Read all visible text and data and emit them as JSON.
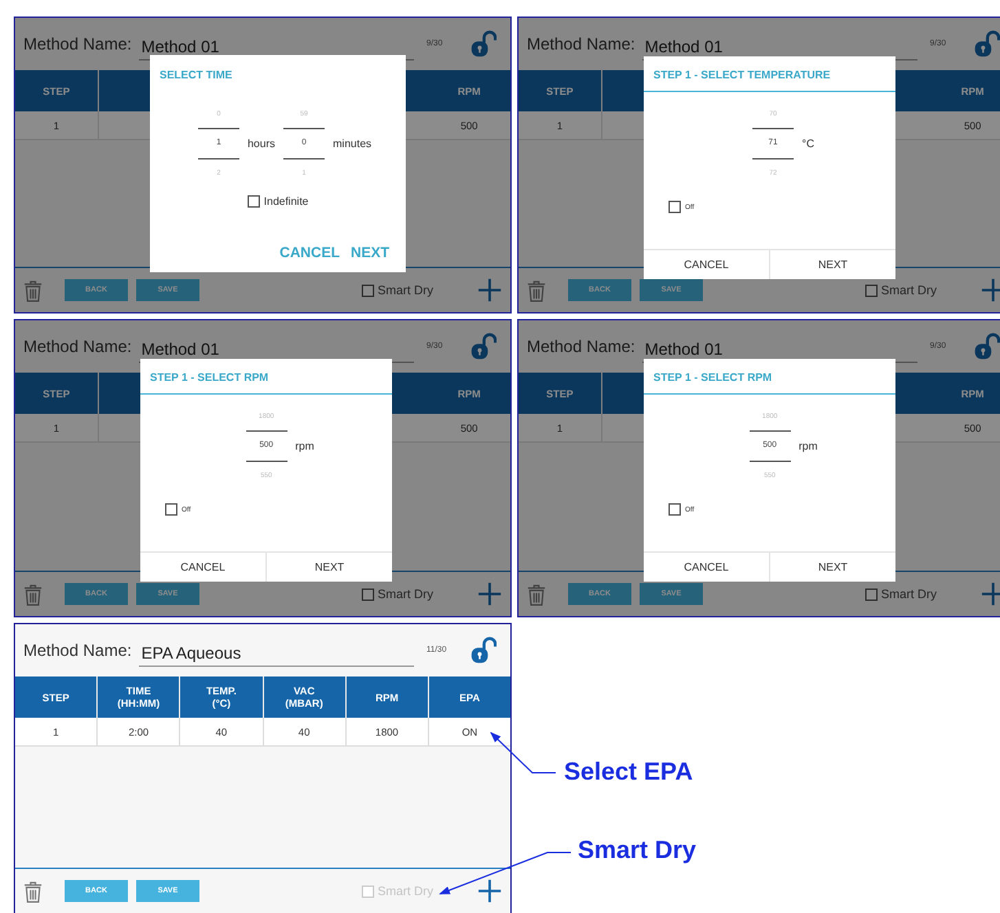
{
  "panels": [
    {
      "method_label": "Method Name:",
      "method_name": "Method 01",
      "counter": "9/30",
      "columns": [
        {
          "lines": [
            "STEP"
          ]
        },
        {
          "lines": [
            "RPM"
          ]
        }
      ],
      "rows": [
        [
          "1",
          "500"
        ]
      ],
      "back": "BACK",
      "save": "SAVE",
      "smart_dry": {
        "label": "Smart Dry",
        "checked": false,
        "disabled": false
      },
      "dialog": {
        "title": "SELECT TIME",
        "kind": "inline",
        "pickers": [
          {
            "above": "0",
            "value": "1",
            "below": "2",
            "unit": "hours"
          },
          {
            "above": "59",
            "value": "0",
            "below": "1",
            "unit": "minutes"
          }
        ],
        "option": {
          "label": "Indefinite",
          "checked": false
        },
        "buttons": [
          "CANCEL",
          "NEXT"
        ]
      }
    },
    {
      "method_label": "Method Name:",
      "method_name": "Method 01",
      "counter": "9/30",
      "columns": [
        {
          "lines": [
            "STEP"
          ]
        },
        {
          "lines": [
            "RPM"
          ]
        }
      ],
      "rows": [
        [
          "1",
          "500"
        ]
      ],
      "back": "BACK",
      "save": "SAVE",
      "smart_dry": {
        "label": "Smart Dry",
        "checked": false,
        "disabled": false
      },
      "dialog": {
        "title": "STEP 1 - SELECT TEMPERATURE",
        "kind": "split",
        "pickers": [
          {
            "above": "70",
            "value": "71",
            "below": "72",
            "unit": "°C"
          }
        ],
        "option": {
          "label": "Off",
          "checked": false
        },
        "buttons": [
          "CANCEL",
          "NEXT"
        ]
      }
    },
    {
      "method_label": "Method Name:",
      "method_name": "Method 01",
      "counter": "9/30",
      "columns": [
        {
          "lines": [
            "STEP"
          ]
        },
        {
          "lines": [
            "RPM"
          ]
        }
      ],
      "rows": [
        [
          "1",
          "500"
        ]
      ],
      "back": "BACK",
      "save": "SAVE",
      "smart_dry": {
        "label": "Smart Dry",
        "checked": false,
        "disabled": false
      },
      "dialog": {
        "title": "STEP 1 - SELECT RPM",
        "kind": "split",
        "pickers": [
          {
            "above": "1800",
            "value": "500",
            "below": "550",
            "unit": "rpm"
          }
        ],
        "option": {
          "label": "Off",
          "checked": false
        },
        "buttons": [
          "CANCEL",
          "NEXT"
        ]
      }
    },
    {
      "method_label": "Method Name:",
      "method_name": "Method 01",
      "counter": "9/30",
      "columns": [
        {
          "lines": [
            "STEP"
          ]
        },
        {
          "lines": [
            "RPM"
          ]
        }
      ],
      "rows": [
        [
          "1",
          "500"
        ]
      ],
      "back": "BACK",
      "save": "SAVE",
      "smart_dry": {
        "label": "Smart Dry",
        "checked": false,
        "disabled": false
      },
      "dialog": {
        "title": "STEP 1 - SELECT RPM",
        "kind": "split",
        "pickers": [
          {
            "above": "1800",
            "value": "500",
            "below": "550",
            "unit": "rpm"
          }
        ],
        "option": {
          "label": "Off",
          "checked": false
        },
        "buttons": [
          "CANCEL",
          "NEXT"
        ]
      }
    },
    {
      "method_label": "Method Name:",
      "method_name": "EPA Aqueous",
      "counter": "11/30",
      "columns": [
        {
          "lines": [
            "STEP"
          ]
        },
        {
          "lines": [
            "TIME",
            "(HH:MM)"
          ]
        },
        {
          "lines": [
            "TEMP.",
            "(°C)"
          ]
        },
        {
          "lines": [
            "VAC",
            "(MBAR)"
          ]
        },
        {
          "lines": [
            "RPM"
          ]
        },
        {
          "lines": [
            "EPA"
          ]
        }
      ],
      "rows": [
        [
          "1",
          "2:00",
          "40",
          "40",
          "1800",
          "ON"
        ]
      ],
      "back": "BACK",
      "save": "SAVE",
      "smart_dry": {
        "label": "Smart Dry",
        "checked": false,
        "disabled": true
      }
    }
  ],
  "annotations": [
    {
      "text": "Select EPA"
    },
    {
      "text": "Smart Dry"
    }
  ]
}
